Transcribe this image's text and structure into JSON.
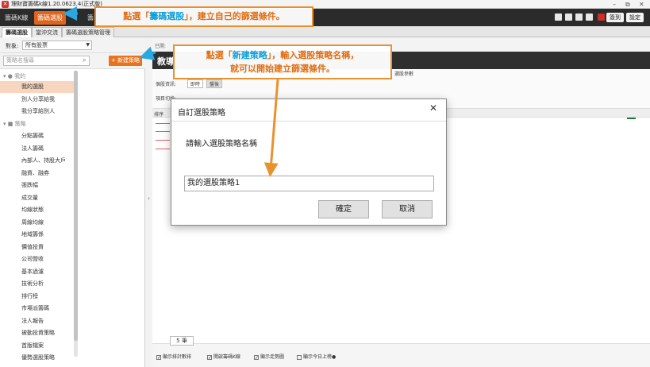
{
  "window": {
    "title": "理財寶籌碼k線1.20.0623.4(正式版)",
    "controls": [
      "–",
      "⧉",
      "✕"
    ]
  },
  "menu": {
    "tab1": "籌碼K線",
    "tab2_active": "籌碼選股",
    "tab3": "籌",
    "btn_signin": "簽到",
    "btn_settings": "設定"
  },
  "subtabs": [
    "籌碼選股",
    "當沖交流",
    "籌碼選股策略管理"
  ],
  "left": {
    "target_label": "對象:",
    "target_value": "所有股票",
    "search_placeholder": "策略名搜尋",
    "new_strategy_label": "+ 新建策略",
    "group_mine": "我的",
    "items_mine": [
      "我的選股",
      "別人分享給我",
      "我分享給別人"
    ],
    "group_strategy": "策略",
    "items_strategy": [
      "分點籌碼",
      "法人籌碼",
      "內部人、持股大戶",
      "融資、融券",
      "張跌幅",
      "成交量",
      "均線狀態",
      "周線均線",
      "地域籌係",
      "價值投資",
      "公司營收",
      "基本過濾",
      "技術分析",
      "排行榜",
      "市場派籌碼",
      "法人報告",
      "被動投資策略",
      "首版檔案",
      "優勢選股策略"
    ]
  },
  "main": {
    "head_label": "已開:",
    "title_fragment": "教導",
    "param_label1": "個股資訊:",
    "param_toggle1": "即時",
    "param_toggle2": "盤後",
    "param_label2": "項目切換:",
    "param_tag": "選股參數",
    "results_col": "排序",
    "page_count": "5 筆",
    "checks": [
      "顯示排計數排",
      "開啟籌碼K線",
      "顯示走勢圖",
      "顯示今日上榜●"
    ]
  },
  "dialog": {
    "title": "自訂選股策略",
    "close": "✕",
    "prompt": "請輸入選股策略名稱",
    "input_value": "我的選股策略1",
    "ok": "確定",
    "cancel": "取消"
  },
  "callouts": {
    "c1_pre": "點選「",
    "c1_hl": "籌碼選股",
    "c1_post": "」，建立自己的篩選條件。",
    "c2_pre": "點選「",
    "c2_hl": "新建策略",
    "c2_post": "」，輸入選股策略名稱，",
    "c2_line2": "就可以開始建立篩選條件。"
  },
  "colors": {
    "accent": "#e0641c",
    "callout_border": "#e8922f",
    "highlight": "#0d9ed8"
  }
}
